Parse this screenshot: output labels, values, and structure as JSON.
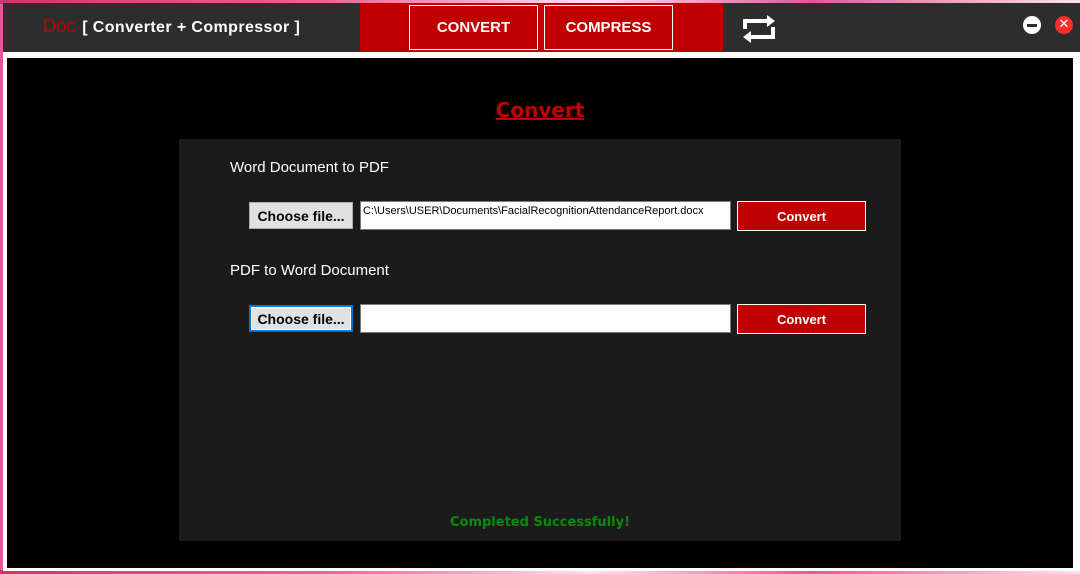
{
  "app": {
    "brand_prefix": "Doc",
    "brand_title": "[ Converter  +  Compressor ]"
  },
  "nav": {
    "convert_label": "CONVERT",
    "compress_label": "COMPRESS"
  },
  "window_controls": {
    "minimize_icon": "minus-circle-icon",
    "close_icon": "x-circle-icon",
    "close_glyph": "✕"
  },
  "page": {
    "title": "Convert"
  },
  "word_to_pdf": {
    "label": "Word Document to PDF",
    "choose_label": "Choose file...",
    "path_value": "C:\\Users\\USER\\Documents\\FacialRecognitionAttendanceReport.docx",
    "convert_label": "Convert"
  },
  "pdf_to_word": {
    "label": "PDF to Word Document",
    "choose_label": "Choose file...",
    "path_value": "",
    "convert_label": "Convert"
  },
  "status": {
    "message": "Completed Successfully!"
  },
  "colors": {
    "accent": "#c00000",
    "titlebar": "#2d2d2d",
    "panel": "#1b1b1b",
    "success": "#0b8a0b"
  }
}
